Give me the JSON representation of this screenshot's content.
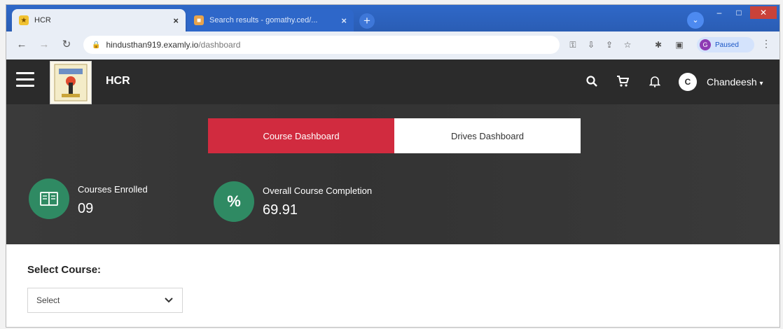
{
  "browser": {
    "tabs": [
      {
        "title": "HCR",
        "active": true
      },
      {
        "title": "Search results - gomathy.ced/...",
        "active": false
      }
    ],
    "url": {
      "host": "hindusthan919.examly.io",
      "path": "/dashboard"
    },
    "profile_status": "Paused",
    "profile_initial": "G"
  },
  "header": {
    "brand": "HCR",
    "user_initial": "C",
    "username": "Chandeesh"
  },
  "dashboard_tabs": [
    {
      "label": "Course Dashboard",
      "active": true
    },
    {
      "label": "Drives Dashboard",
      "active": false
    }
  ],
  "stats": [
    {
      "label": "Courses Enrolled",
      "value": "09",
      "icon": "book-icon"
    },
    {
      "label": "Overall Course Completion",
      "value": "69.91",
      "icon": "percent-icon",
      "symbol": "%"
    }
  ],
  "select_course": {
    "label": "Select Course:",
    "value": "Select"
  },
  "colors": {
    "active_tab": "#d12b3f",
    "stat_icon": "#2f8a63",
    "header": "#2b2b2b"
  }
}
